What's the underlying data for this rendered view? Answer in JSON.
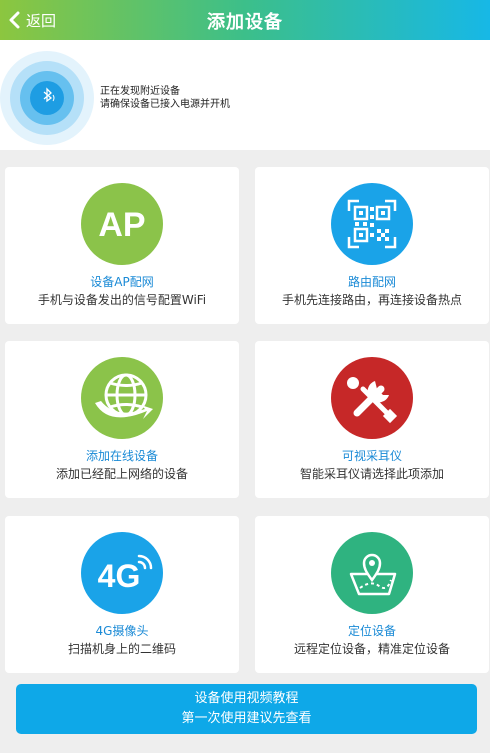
{
  "header": {
    "back_label": "返回",
    "title": "添加设备"
  },
  "discover": {
    "line1": "正在发现附近设备",
    "line2": "请确保设备已接入电源并开机"
  },
  "cards": [
    {
      "icon_text": "AP",
      "label": "设备AP配网",
      "desc": "手机与设备发出的信号配置WiFi"
    },
    {
      "label": "路由配网",
      "desc": "手机先连接路由，再连接设备热点"
    },
    {
      "label": "添加在线设备",
      "desc": "添加已经配上网络的设备"
    },
    {
      "label": "可视采耳仪",
      "desc": "智能采耳仪请选择此项添加"
    },
    {
      "icon_text": "4G",
      "label": "4G摄像头",
      "desc": "扫描机身上的二维码"
    },
    {
      "label": "定位设备",
      "desc": "远程定位设备，精准定位设备"
    }
  ],
  "tutorial": {
    "line1": "设备使用视频教程",
    "line2": "第一次使用建议先查看"
  },
  "colors": {
    "ap_green": "#8bc34a",
    "router_blue": "#1aa3e8",
    "online_green": "#8bc34a",
    "ear_red": "#c62828",
    "camera_blue": "#1aa3e8",
    "location_green": "#2fb380",
    "label_blue": "#1a8ad6",
    "button_blue": "#0ea8e8"
  }
}
